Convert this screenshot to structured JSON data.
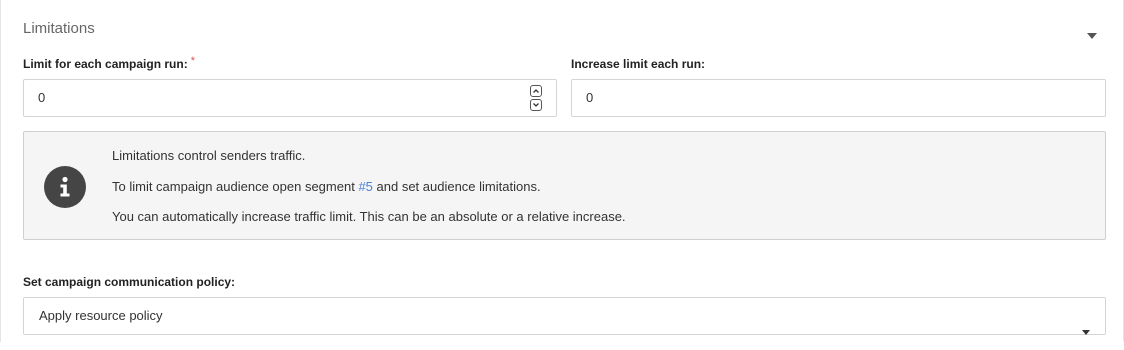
{
  "section": {
    "title": "Limitations",
    "collapse_icon": "caret-down-icon"
  },
  "fields": {
    "limit_label": "Limit for each campaign run:",
    "limit_required_mark": "*",
    "limit_value": "0",
    "increase_label": "Increase limit each run:",
    "increase_value": "0"
  },
  "info": {
    "icon": "info-circle-icon",
    "line1": "Limitations control senders traffic.",
    "line2_prefix": "To limit campaign audience open segment ",
    "line2_link": "#5",
    "line2_suffix": " and set audience limitations.",
    "line3": "You can automatically increase traffic limit. This can be an absolute or a relative increase."
  },
  "policy": {
    "label": "Set campaign communication policy:",
    "selected": "Apply resource policy"
  },
  "colors": {
    "link": "#4a7fd6",
    "required": "#d9534f",
    "info_bg": "#f5f5f5",
    "info_icon": "#454545"
  }
}
